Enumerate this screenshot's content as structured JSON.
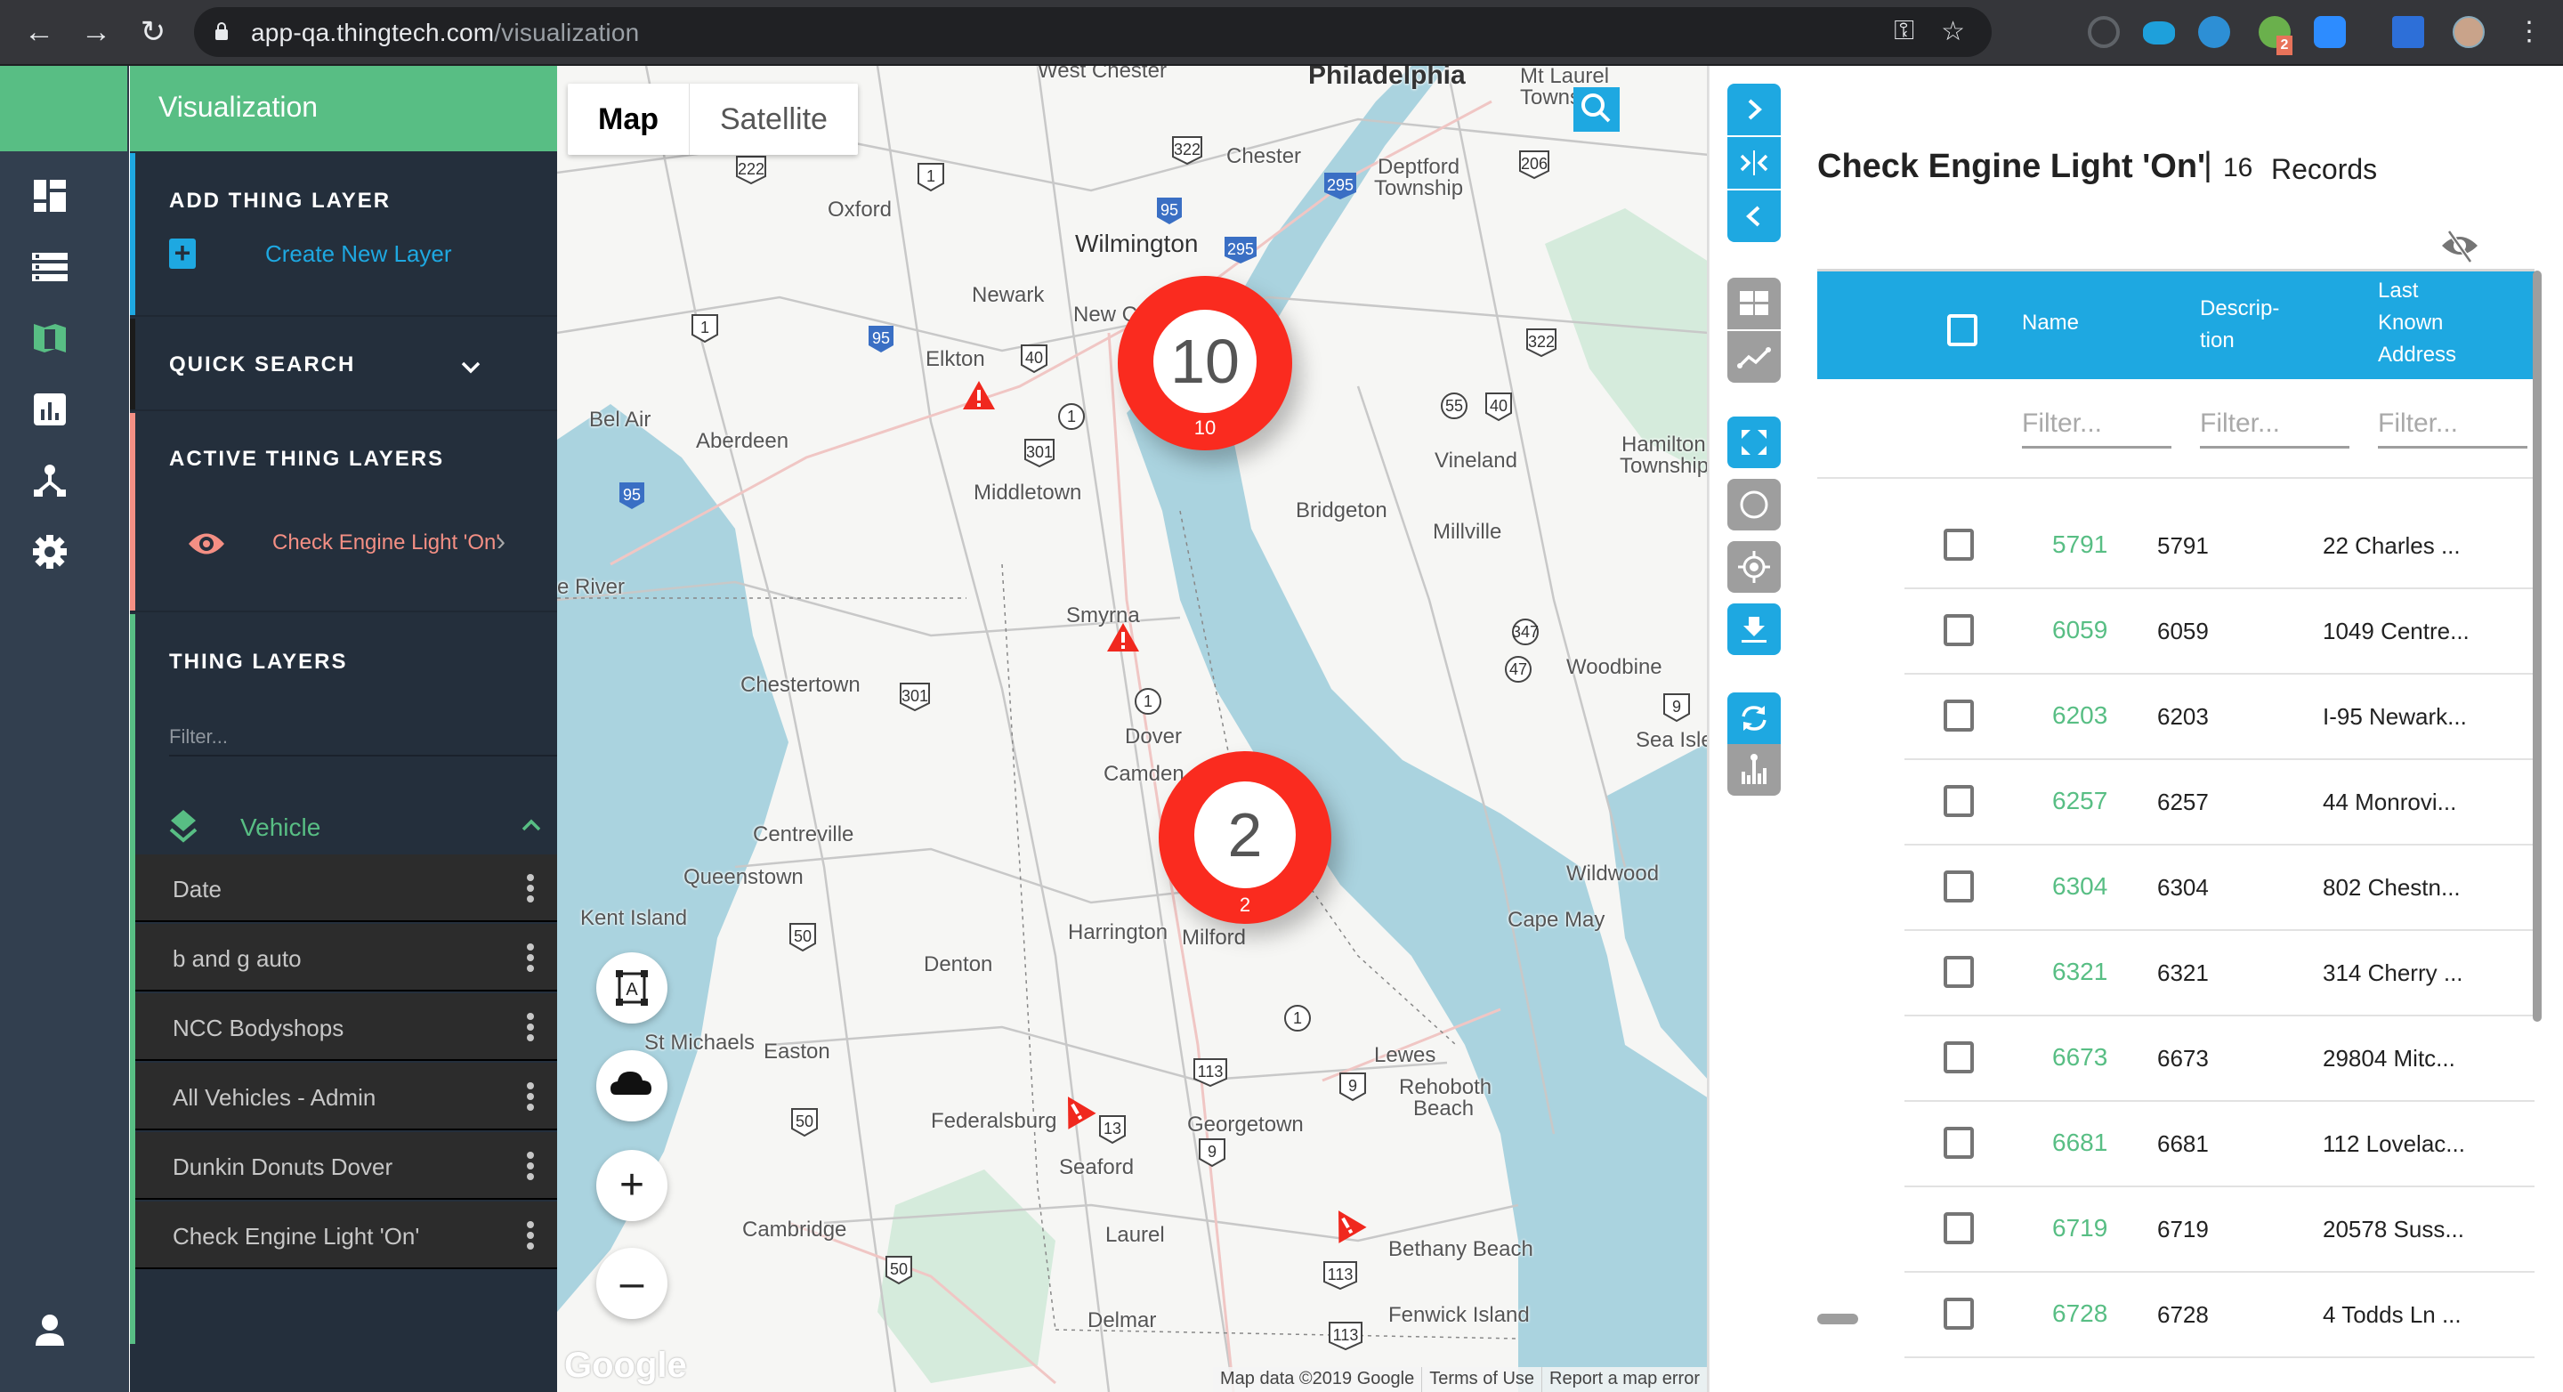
{
  "browser": {
    "url_host": "app-qa.thingtech.com",
    "url_path": "/visualization",
    "extension_badge": "2"
  },
  "sidebar": {
    "title": "Visualization",
    "nav_icons": [
      "dashboard-icon",
      "list-icon",
      "map-icon",
      "chart-icon",
      "hierarchy-icon",
      "settings-icon",
      "user-icon"
    ],
    "add_layer": {
      "heading": "ADD THING LAYER",
      "create_label": "Create New Layer"
    },
    "quick_search": {
      "heading": "QUICK SEARCH"
    },
    "active_layers": {
      "heading": "ACTIVE THING LAYERS",
      "items": [
        {
          "label": "Check Engine Light 'On'"
        }
      ]
    },
    "thing_layers": {
      "heading": "THING LAYERS",
      "filter_placeholder": "Filter...",
      "group": "Vehicle",
      "items": [
        {
          "label": "Date"
        },
        {
          "label": "b and g auto"
        },
        {
          "label": "NCC Bodyshops"
        },
        {
          "label": "All Vehicles - Admin"
        },
        {
          "label": "Dunkin Donuts Dover"
        },
        {
          "label": "Check Engine Light 'On'"
        }
      ]
    },
    "colors": {
      "accent_green": "#58be84",
      "accent_blue": "#1ea8e1",
      "accent_red": "#f48f84"
    }
  },
  "map": {
    "type_tabs": [
      {
        "label": "Map",
        "active": true
      },
      {
        "label": "Satellite",
        "active": false
      }
    ],
    "clusters": [
      {
        "value": "10",
        "count_label": "10"
      },
      {
        "value": "2",
        "count_label": "2"
      }
    ],
    "labels": {
      "philadelphia": "Philadelphia",
      "west_chester": "West Chester",
      "mt_laurel": "Mt Laurel",
      "town": "Towns",
      "chester": "Chester",
      "deptford": "Deptford",
      "township": "Township",
      "oxford": "Oxford",
      "wilmington": "Wilmington",
      "newark": "Newark",
      "new_castle": "New C",
      "elkton": "Elkton",
      "bel_air": "Bel Air",
      "aberdeen": "Aberdeen",
      "middletown": "Middletown",
      "vineland": "Vineland",
      "hamilton": "Hamilton",
      "hamilton_twp": "Township",
      "bridgeton": "Bridgeton",
      "millville": "Millville",
      "river": "e River",
      "smyrna": "Smyrna",
      "chestertown": "Chestertown",
      "woodbine": "Woodbine",
      "dover": "Dover",
      "camden": "Camden",
      "sea_isle": "Sea Isle",
      "centreville": "Centreville",
      "queenstown": "Queenstown",
      "kent_island": "Kent Island",
      "wildwood": "Wildwood",
      "cape_may": "Cape May",
      "harrington": "Harrington",
      "milford": "Milford",
      "denton": "Denton",
      "st_michaels": "St Michaels",
      "easton": "Easton",
      "lewes": "Lewes",
      "rehoboth": "Rehoboth",
      "beach": "Beach",
      "federalsburg": "Federalsburg",
      "georgetown": "Georgetown",
      "seaford": "Seaford",
      "cambridge": "Cambridge",
      "laurel": "Laurel",
      "bethany": "Bethany Beach",
      "delmar": "Delmar",
      "fenwick": "Fenwick Island"
    },
    "google_logo": "Google",
    "attribution": [
      "Map data ©2019 Google",
      "Terms of Use",
      "Report a map error"
    ]
  },
  "panel": {
    "title": "Check Engine Light 'On'",
    "separator": "|",
    "record_count": "16",
    "records_label": "Records",
    "columns": [
      {
        "label": "Name"
      },
      {
        "label": "Descrip-\ntion"
      },
      {
        "label": "Last\nKnown\nAddress"
      }
    ],
    "filter_placeholder": "Filter...",
    "rows": [
      {
        "name": "5791",
        "description": "5791",
        "address": "22 Charles ..."
      },
      {
        "name": "6059",
        "description": "6059",
        "address": "1049 Centre..."
      },
      {
        "name": "6203",
        "description": "6203",
        "address": "I-95 Newark..."
      },
      {
        "name": "6257",
        "description": "6257",
        "address": "44 Monrovi..."
      },
      {
        "name": "6304",
        "description": "6304",
        "address": "802 Chestn..."
      },
      {
        "name": "6321",
        "description": "6321",
        "address": "314 Cherry ..."
      },
      {
        "name": "6673",
        "description": "6673",
        "address": "29804 Mitc..."
      },
      {
        "name": "6681",
        "description": "6681",
        "address": "112 Lovelac..."
      },
      {
        "name": "6719",
        "description": "6719",
        "address": "20578 Suss..."
      },
      {
        "name": "6728",
        "description": "6728",
        "address": "4 Todds Ln ..."
      }
    ]
  }
}
